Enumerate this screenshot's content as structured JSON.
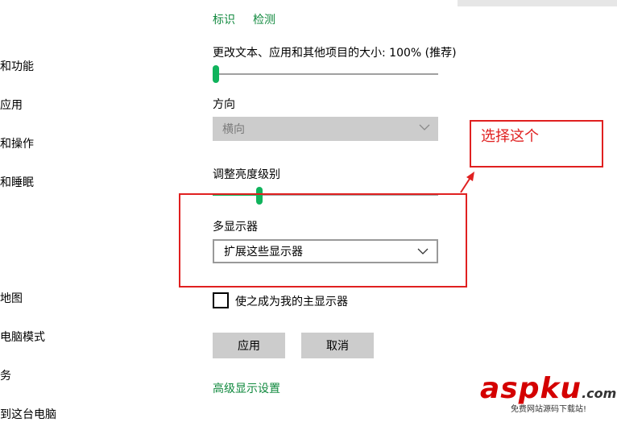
{
  "top_links": {
    "identify": "标识",
    "detect": "检测"
  },
  "sidebar": {
    "items": [
      "和功能",
      "应用",
      "和操作",
      "和睡眠",
      "地图",
      "电脑模式",
      "务",
      "到这台电脑"
    ]
  },
  "scale": {
    "label": "更改文本、应用和其他项目的大小: 100% (推荐)",
    "level_percent": 0
  },
  "orientation": {
    "label": "方向",
    "value": "横向"
  },
  "brightness": {
    "label": "调整亮度级别",
    "level_percent": 20
  },
  "multi_display": {
    "label": "多显示器",
    "value": "扩展这些显示器"
  },
  "main_display_checkbox": {
    "label": "使之成为我的主显示器",
    "checked": false
  },
  "buttons": {
    "apply": "应用",
    "cancel": "取消"
  },
  "advanced_link": "高级显示设置",
  "annotation": {
    "text": "选择这个",
    "color": "#e02020"
  },
  "watermark": {
    "main": "aspku",
    "suffix": ".com",
    "sub": "免费网站源码下载站!"
  },
  "colors": {
    "accent": "#10893e",
    "slider_thumb": "#10b35c",
    "annotation": "#e02020"
  }
}
